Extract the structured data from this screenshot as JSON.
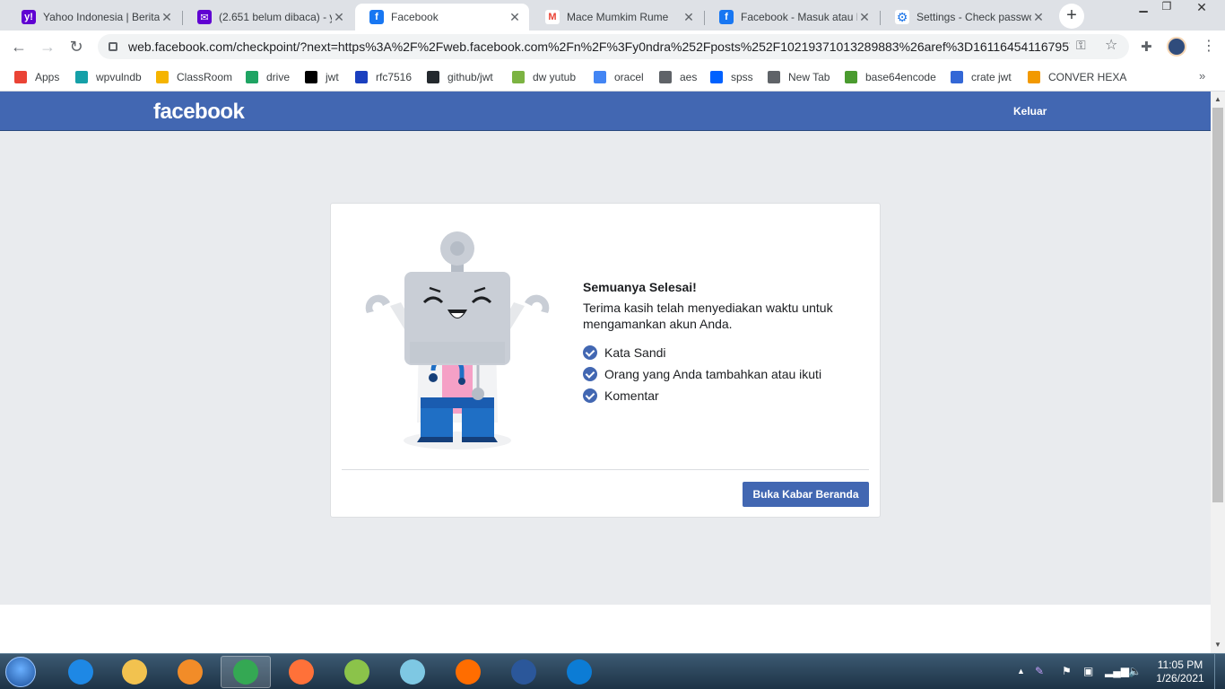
{
  "browser": {
    "tabs": [
      {
        "title": "Yahoo Indonesia | Berita",
        "favicon_color": "#6001d2",
        "favicon_glyph": "y!"
      },
      {
        "title": "(2.651 belum dibaca) - y",
        "favicon_color": "#6001d2",
        "favicon_glyph": "✉"
      },
      {
        "title": "Facebook",
        "favicon_color": "#1877f2",
        "favicon_glyph": "f"
      },
      {
        "title": "Mace Mumkim Rume",
        "favicon_color": "#ea4335",
        "favicon_glyph": "M"
      },
      {
        "title": "Facebook - Masuk atau D",
        "favicon_color": "#1877f2",
        "favicon_glyph": "f"
      },
      {
        "title": "Settings - Check passwo",
        "favicon_color": "#1a73e8",
        "favicon_glyph": "⚙"
      }
    ],
    "active_tab_index": 2,
    "url": "web.facebook.com/checkpoint/?next=https%3A%2F%2Fweb.facebook.com%2Fn%2F%3Fy0ndra%252Fposts%252F10219371013289883%26aref%3D161164541167957...",
    "bookmarks": [
      {
        "label": "Apps",
        "icon": "apps-grid-icon",
        "color": "#ea4335"
      },
      {
        "label": "wpvulndb",
        "icon": "wpvulndb-icon",
        "color": "#15a0a8"
      },
      {
        "label": "ClassRoom",
        "icon": "classroom-icon",
        "color": "#f5b400"
      },
      {
        "label": "drive",
        "icon": "drive-icon",
        "color": "#1fa463"
      },
      {
        "label": "jwt",
        "icon": "jwt-icon",
        "color": "#000000"
      },
      {
        "label": "rfc7516",
        "icon": "rfc-icon",
        "color": "#1a3fbf"
      },
      {
        "label": "github/jwt",
        "icon": "github-icon",
        "color": "#24292e"
      },
      {
        "label": "dw yutub",
        "icon": "download-icon",
        "color": "#7cb342"
      },
      {
        "label": "oracel",
        "icon": "document-icon",
        "color": "#4285f4"
      },
      {
        "label": "aes",
        "icon": "globe-icon",
        "color": "#5f6368"
      },
      {
        "label": "spss",
        "icon": "dropbox-icon",
        "color": "#0061ff"
      },
      {
        "label": "New Tab",
        "icon": "globe-icon",
        "color": "#5f6368"
      },
      {
        "label": "base64encode",
        "icon": "b64-icon",
        "color": "#4a9b2f"
      },
      {
        "label": "crate jwt",
        "icon": "crate-icon",
        "color": "#3367d6"
      },
      {
        "label": "CONVER HEXA",
        "icon": "r-icon",
        "color": "#f29900"
      }
    ]
  },
  "facebook": {
    "logo": "facebook",
    "logout_label": "Keluar",
    "brand_color": "#4267b2"
  },
  "card": {
    "title": "Semuanya Selesai!",
    "description": "Terima kasih telah menyediakan waktu untuk mengamankan akun Anda.",
    "checklist": [
      "Kata Sandi",
      "Orang yang Anda tambahkan atau ikuti",
      "Komentar"
    ],
    "button_label": "Buka Kabar Beranda"
  },
  "taskbar": {
    "apps": [
      {
        "name": "internet-explorer",
        "color": "#1e88e5"
      },
      {
        "name": "file-explorer",
        "color": "#f2c24f"
      },
      {
        "name": "media-player",
        "color": "#f28c28"
      },
      {
        "name": "chrome",
        "color": "#34a853"
      },
      {
        "name": "firefox",
        "color": "#ff7139"
      },
      {
        "name": "notepad-plus",
        "color": "#8bc34a"
      },
      {
        "name": "notes",
        "color": "#7ec8e3"
      },
      {
        "name": "uc-browser",
        "color": "#ff6d00"
      },
      {
        "name": "word",
        "color": "#2b579a"
      },
      {
        "name": "edge",
        "color": "#0c7cd5"
      }
    ],
    "active_app_index": 3,
    "time": "11:05 PM",
    "date": "1/26/2021"
  }
}
